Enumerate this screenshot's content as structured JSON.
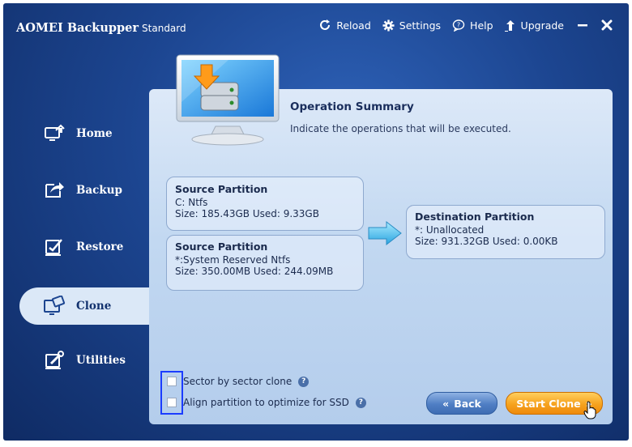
{
  "app": {
    "title": "AOMEI Backupper",
    "edition": "Standard"
  },
  "toolbar": {
    "reload": "Reload",
    "settings": "Settings",
    "help": "Help",
    "upgrade": "Upgrade"
  },
  "sidebar": {
    "items": [
      {
        "label": "Home",
        "icon": "home-icon"
      },
      {
        "label": "Backup",
        "icon": "backup-icon"
      },
      {
        "label": "Restore",
        "icon": "restore-icon"
      },
      {
        "label": "Clone",
        "icon": "clone-icon",
        "active": true
      },
      {
        "label": "Utilities",
        "icon": "utilities-icon"
      }
    ]
  },
  "summary": {
    "title": "Operation Summary",
    "description": "Indicate the operations that will be executed."
  },
  "sources": [
    {
      "title": "Source Partition",
      "name": "C: Ntfs",
      "size": "Size: 185.43GB  Used: 9.33GB"
    },
    {
      "title": "Source Partition",
      "name": "*:System Reserved Ntfs",
      "size": "Size: 350.00MB  Used: 244.09MB"
    }
  ],
  "destination": {
    "title": "Destination Partition",
    "name": "*: Unallocated",
    "size": "Size: 931.32GB  Used: 0.00KB"
  },
  "options": [
    {
      "label": "Sector by sector clone",
      "checked": false
    },
    {
      "label": "Align partition to optimize for SSD",
      "checked": false
    }
  ],
  "buttons": {
    "back": "Back",
    "start": "Start Clone"
  },
  "colors": {
    "accent": "#f6a21e",
    "background": "#1c4590",
    "panel": "#c2d8f1"
  }
}
